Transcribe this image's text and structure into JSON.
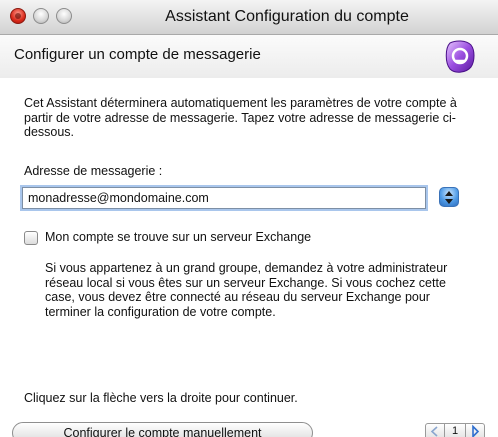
{
  "window": {
    "title": "Assistant Configuration du compte"
  },
  "header": {
    "title": "Configurer un compte de messagerie",
    "logo_icon": "entourage-logo-icon"
  },
  "content": {
    "intro": "Cet Assistant déterminera automatiquement les paramètres de votre compte à partir de votre adresse de messagerie. Tapez votre adresse de messagerie ci-dessous.",
    "email_label": "Adresse de messagerie :",
    "email_value": "monadresse@mondomaine.com",
    "stepper_icon": "up-down-arrows-icon",
    "exchange_checkbox_label": "Mon compte se trouve sur un serveur Exchange",
    "exchange_checked": false,
    "exchange_help": "Si vous appartenez à un grand groupe, demandez à votre administrateur réseau local si vous êtes sur un serveur Exchange. Si vous cochez cette case, vous devez être connecté au réseau du serveur Exchange pour terminer la configuration de votre compte.",
    "continue_hint": "Cliquez sur la flèche vers la droite pour continuer."
  },
  "footer": {
    "manual_button": "Configurer le compte manuellement",
    "pager": {
      "page": "1",
      "prev_icon": "arrow-left-icon",
      "next_icon": "arrow-right-icon"
    }
  },
  "colors": {
    "accent": "#4f9be6",
    "close_button": "#d9291a",
    "pager_arrow": "#2f6fcf"
  }
}
